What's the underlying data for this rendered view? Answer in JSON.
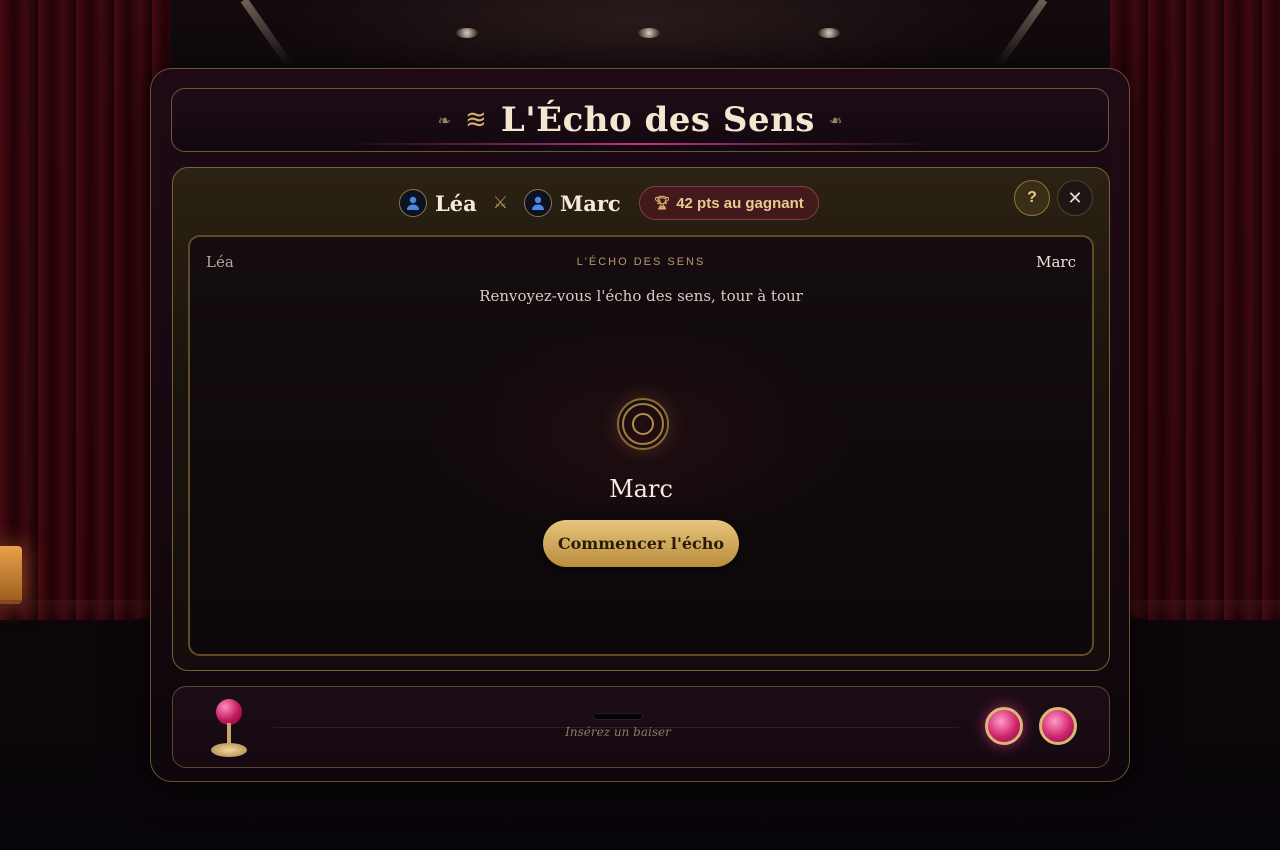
{
  "app": {
    "title": "L'Écho des Sens",
    "title_icon": "waves-icon",
    "ornament": "❧"
  },
  "header": {
    "player_one": {
      "name": "Léa",
      "avatar_icon": "user-icon"
    },
    "versus_icon": "crossed-swords-icon",
    "player_two": {
      "name": "Marc",
      "avatar_icon": "user-icon"
    },
    "prize": {
      "icon": "trophy-icon",
      "label": "42 pts au gagnant"
    },
    "help_label": "?",
    "close_label": "✕"
  },
  "stage": {
    "left_player": "Léa",
    "right_player": "Marc",
    "title": "L'ÉCHO DES SENS",
    "subtitle": "Renvoyez-vous l'écho des sens, tour à tour",
    "current_player": "Marc",
    "start_button_label": "Commencer l'écho",
    "center_icon": "echo-ring-icon"
  },
  "deck": {
    "coin_label": "Insérez un baiser"
  },
  "colors": {
    "accent_gold": "#e6c57c",
    "accent_pink": "#d0266e",
    "panel_border": "#7a6036"
  }
}
